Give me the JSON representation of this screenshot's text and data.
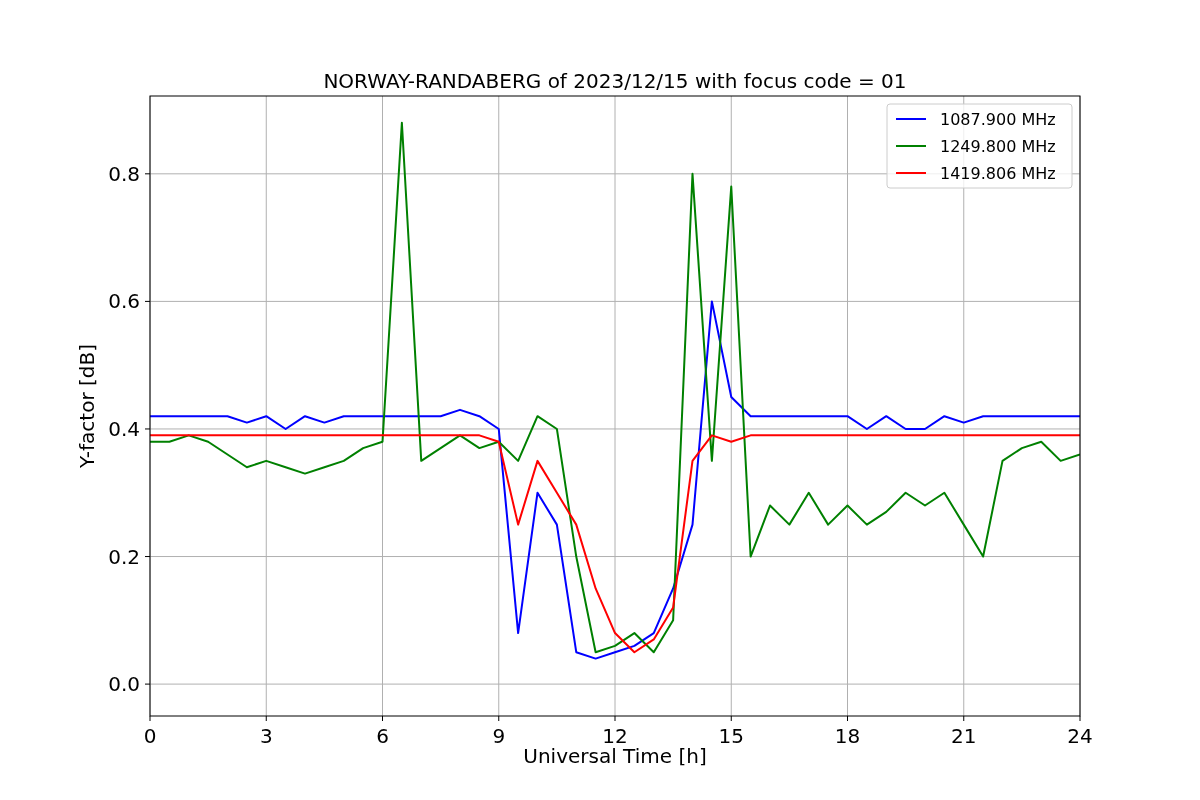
{
  "figure": {
    "chart_data": {
      "type": "line",
      "title": "NORWAY-RANDABERG of 2023/12/15 with focus code = 01",
      "xlabel": "Universal Time [h]",
      "ylabel": "Y-factor [dB]",
      "x": [
        0,
        0.5,
        1,
        1.5,
        2,
        2.5,
        3,
        3.5,
        4,
        4.5,
        5,
        5.5,
        6,
        6.5,
        7,
        7.5,
        8,
        8.5,
        9,
        9.5,
        10,
        10.5,
        11,
        11.5,
        12,
        12.5,
        13,
        13.5,
        14,
        14.5,
        15,
        15.5,
        16,
        16.5,
        17,
        17.5,
        18,
        18.5,
        19,
        19.5,
        20,
        20.5,
        21,
        21.5,
        22,
        22.5,
        23,
        23.5,
        24
      ],
      "series": [
        {
          "name": "1087.900 MHz",
          "color": "#0000ff",
          "values": [
            0.42,
            0.42,
            0.42,
            0.42,
            0.42,
            0.41,
            0.42,
            0.4,
            0.42,
            0.41,
            0.42,
            0.42,
            0.42,
            0.42,
            0.42,
            0.42,
            0.43,
            0.42,
            0.4,
            0.08,
            0.3,
            0.25,
            0.05,
            0.04,
            0.05,
            0.06,
            0.08,
            0.15,
            0.25,
            0.6,
            0.45,
            0.42,
            0.42,
            0.42,
            0.42,
            0.42,
            0.42,
            0.4,
            0.42,
            0.4,
            0.4,
            0.42,
            0.41,
            0.42,
            0.42,
            0.42,
            0.42,
            0.42,
            0.42
          ]
        },
        {
          "name": "1249.800 MHz",
          "color": "#008000",
          "values": [
            0.38,
            0.38,
            0.39,
            0.38,
            0.36,
            0.34,
            0.35,
            0.34,
            0.33,
            0.34,
            0.35,
            0.37,
            0.38,
            0.88,
            0.35,
            0.37,
            0.39,
            0.37,
            0.38,
            0.35,
            0.42,
            0.4,
            0.2,
            0.05,
            0.06,
            0.08,
            0.05,
            0.1,
            0.8,
            0.35,
            0.78,
            0.2,
            0.28,
            0.25,
            0.3,
            0.25,
            0.28,
            0.25,
            0.27,
            0.3,
            0.28,
            0.3,
            0.25,
            0.2,
            0.35,
            0.37,
            0.38,
            0.35,
            0.36
          ]
        },
        {
          "name": "1419.806 MHz",
          "color": "#ff0000",
          "values": [
            0.39,
            0.39,
            0.39,
            0.39,
            0.39,
            0.39,
            0.39,
            0.39,
            0.39,
            0.39,
            0.39,
            0.39,
            0.39,
            0.39,
            0.39,
            0.39,
            0.39,
            0.39,
            0.38,
            0.25,
            0.35,
            0.3,
            0.25,
            0.15,
            0.08,
            0.05,
            0.07,
            0.12,
            0.35,
            0.39,
            0.38,
            0.39,
            0.39,
            0.39,
            0.39,
            0.39,
            0.39,
            0.39,
            0.39,
            0.39,
            0.39,
            0.39,
            0.39,
            0.39,
            0.39,
            0.39,
            0.39,
            0.39,
            0.39
          ]
        }
      ],
      "xlim": [
        0,
        24
      ],
      "ylim": [
        -0.05,
        0.922
      ],
      "xticks": [
        0,
        3,
        6,
        9,
        12,
        15,
        18,
        21,
        24
      ],
      "grid": true,
      "legend": true,
      "yticks": [
        {
          "value": 0,
          "label": "0.0"
        },
        {
          "value": 0.2,
          "label": "0.2"
        },
        {
          "value": 0.4,
          "label": "0.4"
        },
        {
          "value": 0.6,
          "label": "0.6"
        },
        {
          "value": 0.8,
          "label": "0.8"
        }
      ]
    }
  }
}
